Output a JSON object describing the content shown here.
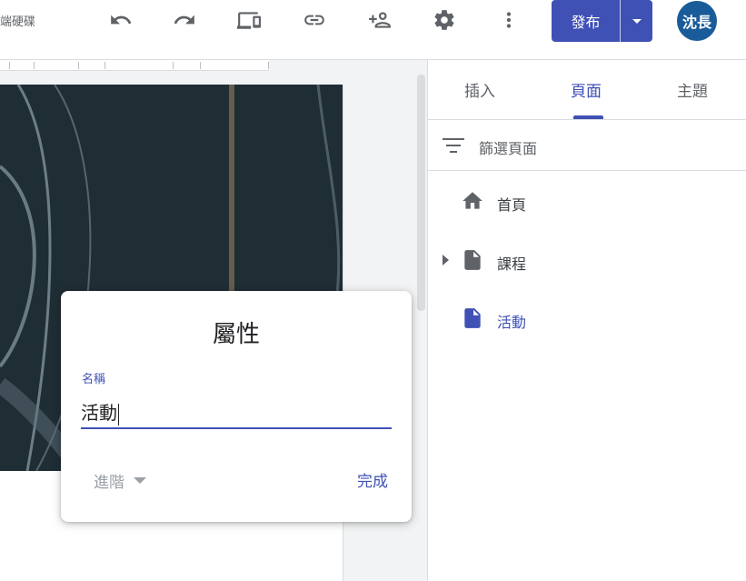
{
  "header": {
    "drive_text": "端硬碟",
    "publish_label": "發布",
    "avatar_initials": "沈長"
  },
  "sidepanel": {
    "tabs": [
      {
        "label": "插入"
      },
      {
        "label": "頁面"
      },
      {
        "label": "主題"
      }
    ],
    "filter_label": "篩選頁面",
    "pages": [
      {
        "label": "首頁",
        "icon": "home-icon"
      },
      {
        "label": "課程",
        "icon": "page-icon"
      },
      {
        "label": "活動",
        "icon": "page-icon"
      }
    ]
  },
  "properties_dialog": {
    "title": "屬性",
    "name_label": "名稱",
    "name_value": "活動",
    "advanced_label": "進階",
    "done_label": "完成"
  },
  "colors": {
    "accent": "#3f51b5",
    "hero_bg": "#1f2d35",
    "avatar_bg": "#1a5c9a"
  }
}
